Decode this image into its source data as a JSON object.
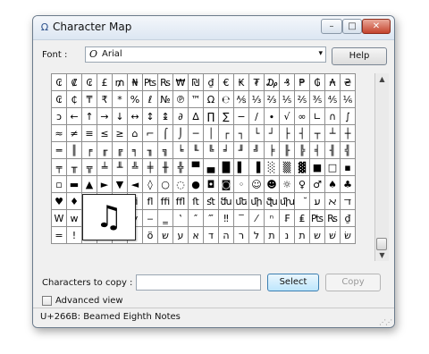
{
  "window": {
    "title": "Character Map",
    "icon": "character-map-icon"
  },
  "window_buttons": {
    "minimize": "–",
    "maximize": "□",
    "close": "✕"
  },
  "font": {
    "label": "Font :",
    "icon_glyph": "O",
    "value": "Arial",
    "dropdown_glyph": "▾"
  },
  "help_label": "Help",
  "grid": {
    "rows": [
      [
        "₢",
        "₡",
        "₢",
        "£",
        "₥",
        "₦",
        "₧",
        "₨",
        "₩",
        "₪",
        "₫",
        "€",
        "₭",
        "₮",
        "₯",
        "₰",
        "₱",
        "₲",
        "₳",
        "₴"
      ],
      [
        "₢",
        "₵",
        "₸",
        "₹",
        "*",
        "%",
        "ℓ",
        "№",
        "℗",
        "™",
        "Ω",
        "℮",
        "⅍",
        "⅓",
        "⅔",
        "⅕",
        "⅖",
        "⅗",
        "⅘",
        "⅙"
      ],
      [
        "ↄ",
        "←",
        "↑",
        "→",
        "↓",
        "↔",
        "↕",
        "↨",
        "∂",
        "∆",
        "∏",
        "∑",
        "−",
        "∕",
        "∙",
        "√",
        "∞",
        "∟",
        "∩",
        "∫"
      ],
      [
        "≈",
        "≠",
        "≡",
        "≤",
        "≥",
        "⌂",
        "⌐",
        "⌠",
        "⌡",
        "─",
        "│",
        "┌",
        "┐",
        "└",
        "┘",
        "├",
        "┤",
        "┬",
        "┴",
        "┼"
      ],
      [
        "═",
        "║",
        "╒",
        "╓",
        "╔",
        "╕",
        "╖",
        "╗",
        "╘",
        "╙",
        "╚",
        "╛",
        "╜",
        "╝",
        "╞",
        "╟",
        "╠",
        "╡",
        "╢",
        "╣"
      ],
      [
        "╤",
        "╥",
        "╦",
        "╧",
        "╨",
        "╩",
        "╪",
        "╫",
        "╬",
        "▀",
        "▄",
        "█",
        "▌",
        "▐",
        "░",
        "▒",
        "▓",
        "■",
        "□",
        "▪"
      ],
      [
        "▫",
        "▬",
        "▲",
        "►",
        "▼",
        "◄",
        "◊",
        "○",
        "◌",
        "●",
        "◘",
        "◙",
        "◦",
        "☺",
        "☻",
        "☼",
        "♀",
        "♂",
        "♠",
        "♣"
      ],
      [
        "♥",
        "♦",
        "♪",
        "♫",
        "ﬀ",
        "ﬁ",
        "ﬂ",
        "ﬃ",
        "ﬄ",
        "ﬅ",
        "ﬆ",
        "ﬓ",
        "ﬔ",
        "ﬕ",
        "ﬖ",
        "ﬗ",
        "ﬞ",
        "ﬠ",
        "ﬡ",
        "ﬢ"
      ],
      [
        "W",
        "w",
        "ẅ",
        "ẅ",
        "ỳ",
        "ỳ",
        "‒",
        "‗",
        "‛",
        "″",
        "‴",
        "‼",
        "‾",
        "⁄",
        "ⁿ",
        "₣",
        "₤",
        "₧",
        "₨",
        "₫"
      ],
      [
        "=",
        "!",
        "'",
        "ﬁ",
        "ﬂ",
        "!",
        "ö",
        "ש",
        "ע",
        "א",
        "ד",
        "ה",
        "ר",
        "ל",
        "ת",
        "נ",
        "ת",
        "ש",
        "שׁ",
        "שׂ"
      ]
    ]
  },
  "zoom": {
    "glyph": "♫"
  },
  "scrollbar": {
    "up": "▲",
    "down": "▼"
  },
  "copy": {
    "label": "Characters to copy :",
    "value": "",
    "select_label": "Select",
    "copy_label": "Copy"
  },
  "advanced": {
    "label": "Advanced view",
    "checked": false
  },
  "status": {
    "text": "U+266B: Beamed Eighth Notes"
  }
}
